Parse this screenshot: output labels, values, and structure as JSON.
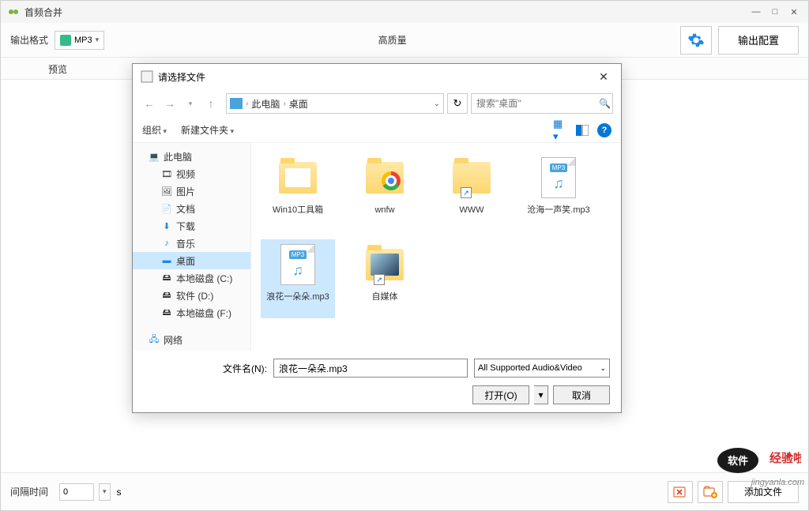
{
  "app": {
    "title": "首频合并",
    "output_format_label": "输出格式",
    "format_value": "MP3",
    "quality": "高质量",
    "output_config": "输出配置",
    "tab_preview": "预览",
    "interval_label": "间隔时间",
    "interval_value": "0",
    "interval_unit": "s",
    "add_file": "添加文件"
  },
  "dialog": {
    "title": "请选择文件",
    "path_segments": [
      "此电脑",
      "桌面"
    ],
    "search_placeholder": "搜索\"桌面\"",
    "organize": "组织",
    "new_folder": "新建文件夹",
    "tree": {
      "this_pc": "此电脑",
      "video": "视频",
      "pictures": "图片",
      "documents": "文档",
      "downloads": "下载",
      "music": "音乐",
      "desktop": "桌面",
      "local_c": "本地磁盘 (C:)",
      "soft_d": "软件 (D:)",
      "local_f": "本地磁盘 (F:)",
      "network": "网络"
    },
    "files": [
      {
        "name": "Win10工具箱",
        "type": "folder"
      },
      {
        "name": "wnfw",
        "type": "folder-chrome"
      },
      {
        "name": "WWW",
        "type": "folder-shortcut"
      },
      {
        "name": "沧海一声笑.mp3",
        "type": "mp3"
      },
      {
        "name": "浪花一朵朵.mp3",
        "type": "mp3",
        "selected": true
      },
      {
        "name": "自媒体",
        "type": "folder-media-shortcut"
      }
    ],
    "filename_label": "文件名(N):",
    "filename_value": "浪花一朵朵.mp3",
    "filter": "All Supported Audio&Video",
    "open_btn": "打开(O)",
    "cancel_btn": "取消"
  },
  "watermark": "jingyanla.com"
}
